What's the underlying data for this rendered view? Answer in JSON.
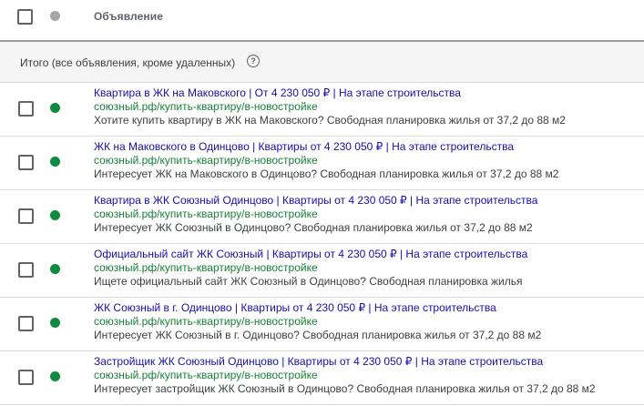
{
  "header": {
    "column_label": "Объявление"
  },
  "total": {
    "label": "Итого (все объявления, кроме удаленных)",
    "help_glyph": "?"
  },
  "ads": [
    {
      "headline": "Квартира в ЖК на Маковского | От 4 230 050 ₽ | На этапе строительства",
      "url": "союзный.рф/купить-квартиру/в-новостройке",
      "description": "Хотите купить квартиру в ЖК на Маковского? Свободная планировка жилья от 37,2 до 88 м2",
      "status_color": "#0f8a3e"
    },
    {
      "headline": "ЖК на Маковского в Одинцово | Квартиры от 4 230 050 ₽ | На этапе строительства",
      "url": "союзный.рф/купить-квартиру/в-новостройке",
      "description": "Интересует ЖК на Маковского в Одинцово? Свободная планировка жилья от 37,2 до 88 м2",
      "status_color": "#0f8a3e"
    },
    {
      "headline": "Квартира в ЖК Союзный Одинцово | Квартиры от 4 230 050 ₽ | На этапе строительства",
      "url": "союзный.рф/купить-квартиру/в-новостройке",
      "description": "Интересует ЖК Союзный в Одинцово? Свободная планировка жилья от 37,2 до 88 м2",
      "status_color": "#0f8a3e"
    },
    {
      "headline": "Официальный сайт ЖК Союзный | Квартиры от 4 230 050 ₽ | На этапе строительства",
      "url": "союзный.рф/купить-квартиру/в-новостройке",
      "description": "Ищете официальный сайт ЖК Союзный в Одинцово? Свободная планировка жилья",
      "status_color": "#0f8a3e"
    },
    {
      "headline": "ЖК Союзный в г. Одинцово | Квартиры от 4 230 050 ₽ | На этапе строительства",
      "url": "союзный.рф/купить-квартиру/в-новостройке",
      "description": "Интересует ЖК Союзный в г. Одинцово? Свободная планировка жилья от 37,2 до 88 м2",
      "status_color": "#0f8a3e"
    },
    {
      "headline": "Застройщик ЖК Союзный Одинцово | Квартиры от 4 230 050 ₽ | На этапе строительства",
      "url": "союзный.рф/купить-квартиру/в-новостройке",
      "description": "Интересует застройщик ЖК Союзный в Одинцово? Свободная планировка жилья от 37,2 до 88 м2",
      "status_color": "#0f8a3e"
    }
  ],
  "colors": {
    "header_dot": "#a7a7a7",
    "headline": "#1a0dab",
    "url": "#188038",
    "description": "#3c4043"
  }
}
